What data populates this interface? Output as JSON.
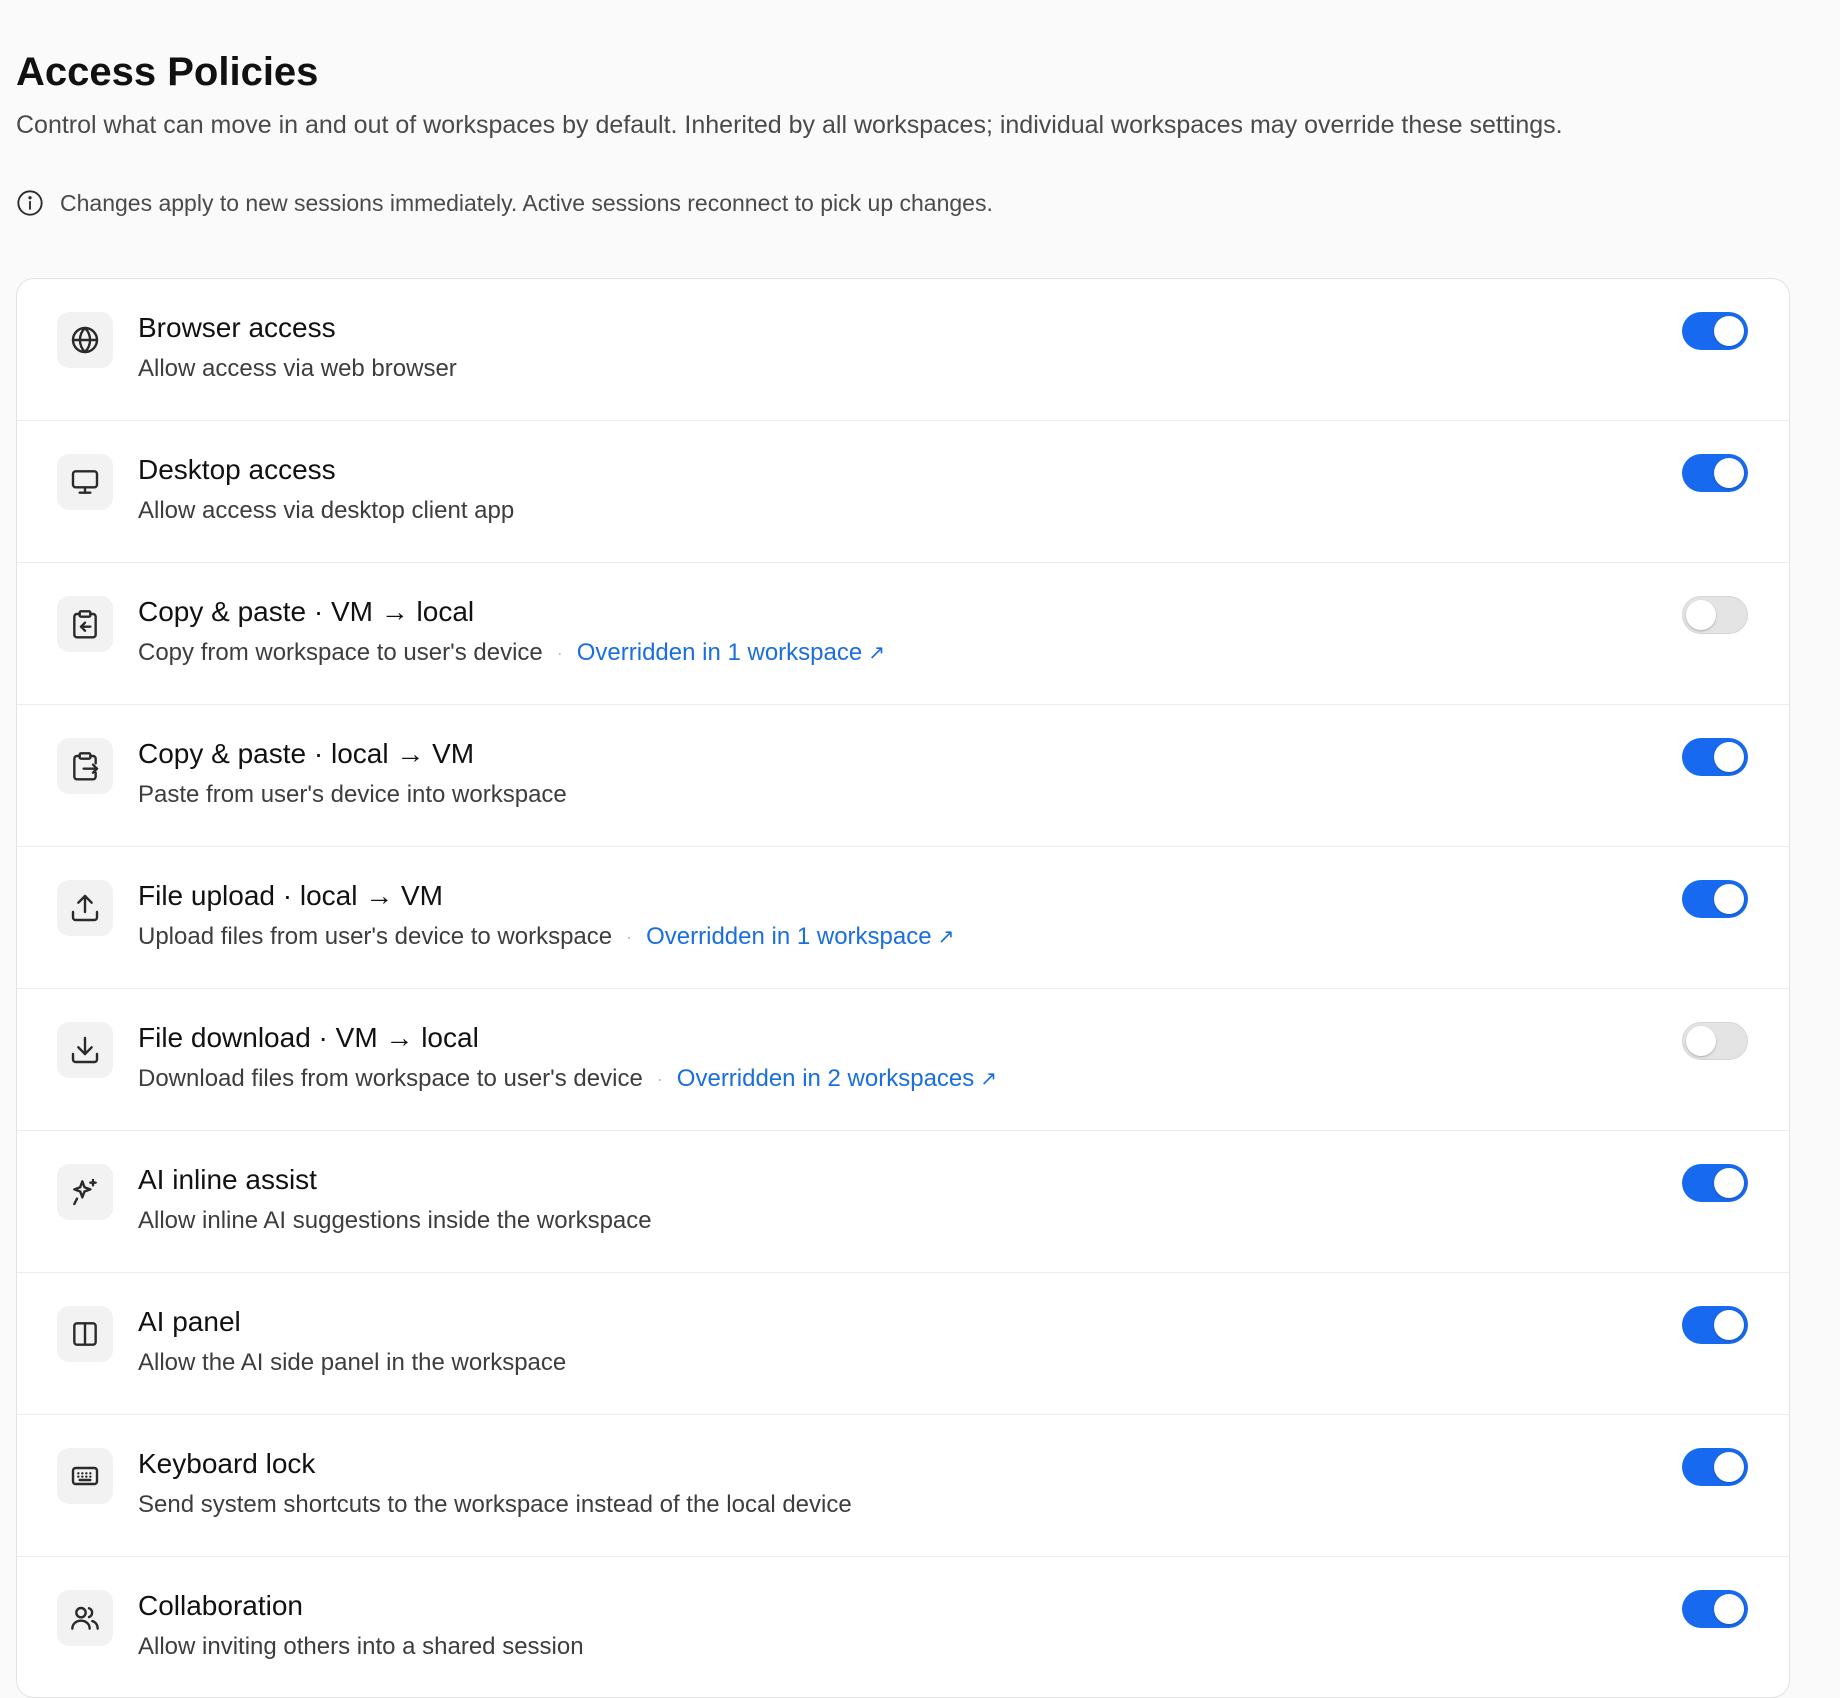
{
  "header": {
    "title": "Access Policies",
    "description": "Control what can move in and out of workspaces by default. Inherited by all workspaces; individual workspaces may override these settings.",
    "notice": "Changes apply to new sessions immediately. Active sessions reconnect to pick up changes."
  },
  "accent_color": "#1769f0",
  "link_color": "#1a6ee0",
  "policies": [
    {
      "icon": "globe-icon",
      "title": "Browser access",
      "subtitle": "Allow access via web browser",
      "override": "",
      "enabled": true
    },
    {
      "icon": "monitor-icon",
      "title": "Desktop access",
      "subtitle": "Allow access via desktop client app",
      "override": "",
      "enabled": true
    },
    {
      "icon": "clipboard-in-icon",
      "title": "Copy & paste · VM → local",
      "subtitle": "Copy from workspace to user's device",
      "override": "Overridden in 1 workspace",
      "enabled": false
    },
    {
      "icon": "clipboard-out-icon",
      "title": "Copy & paste · local → VM",
      "subtitle": "Paste from user's device into workspace",
      "override": "",
      "enabled": true
    },
    {
      "icon": "upload-icon",
      "title": "File upload · local → VM",
      "subtitle": "Upload files from user's device to workspace",
      "override": "Overridden in 1 workspace",
      "enabled": true
    },
    {
      "icon": "download-icon",
      "title": "File download · VM → local",
      "subtitle": "Download files from workspace to user's device",
      "override": "Overridden in 2 workspaces",
      "enabled": false
    },
    {
      "icon": "sparkles-icon",
      "title": "AI inline assist",
      "subtitle": "Allow inline AI suggestions inside the workspace",
      "override": "",
      "enabled": true
    },
    {
      "icon": "side-panel-icon",
      "title": "AI panel",
      "subtitle": "Allow the AI side panel in the workspace",
      "override": "",
      "enabled": true
    },
    {
      "icon": "keyboard-icon",
      "title": "Keyboard lock",
      "subtitle": "Send system shortcuts to the workspace instead of the local device",
      "override": "",
      "enabled": true
    },
    {
      "icon": "users-icon",
      "title": "Collaboration",
      "subtitle": "Allow inviting others into a shared session",
      "override": "",
      "enabled": true
    }
  ]
}
